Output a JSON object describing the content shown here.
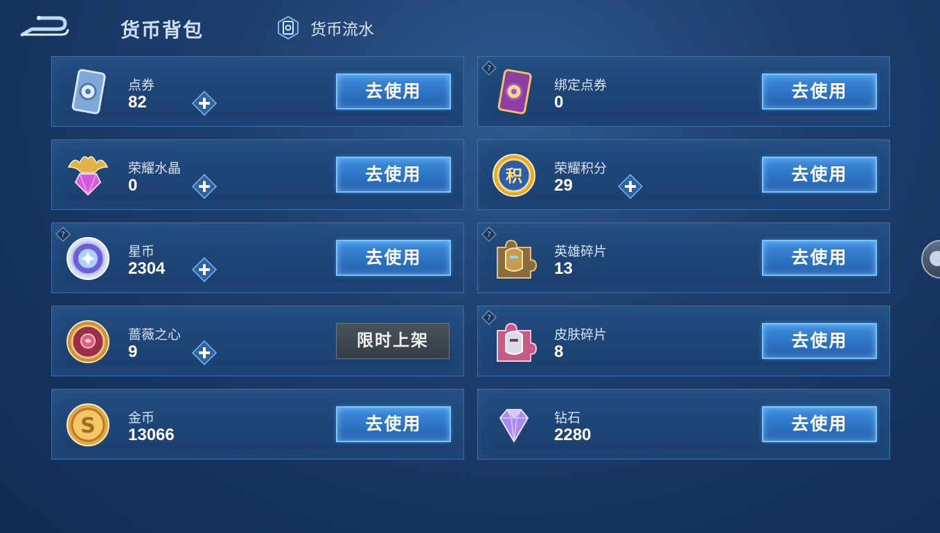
{
  "header": {
    "title": "货币背包",
    "flow_tab_label": "货币流水",
    "back_icon": "back-arrow-icon"
  },
  "currencies": [
    {
      "name": "点券",
      "amount": "82",
      "icon": "voucher-card-blue-icon",
      "has_plus": true,
      "has_help": false,
      "action": "去使用"
    },
    {
      "name": "绑定点券",
      "amount": "0",
      "icon": "voucher-card-purple-icon",
      "has_plus": false,
      "has_help": true,
      "action": "去使用"
    },
    {
      "name": "荣耀水晶",
      "amount": "0",
      "icon": "glory-crystal-icon",
      "has_plus": true,
      "has_help": false,
      "action": "去使用"
    },
    {
      "name": "荣耀积分",
      "amount": "29",
      "icon": "glory-points-coin-icon",
      "has_plus": true,
      "has_help": false,
      "action": "去使用"
    },
    {
      "name": "星币",
      "amount": "2304",
      "icon": "star-coin-icon",
      "has_plus": true,
      "has_help": true,
      "action": "去使用"
    },
    {
      "name": "英雄碎片",
      "amount": "13",
      "icon": "hero-fragment-icon",
      "has_plus": false,
      "has_help": true,
      "action": "去使用"
    },
    {
      "name": "蔷薇之心",
      "amount": "9",
      "icon": "rose-heart-icon",
      "has_plus": true,
      "has_help": false,
      "action": "限时上架"
    },
    {
      "name": "皮肤碎片",
      "amount": "8",
      "icon": "skin-fragment-icon",
      "has_plus": false,
      "has_help": true,
      "action": "去使用"
    },
    {
      "name": "金币",
      "amount": "13066",
      "icon": "gold-coin-icon",
      "has_plus": false,
      "has_help": false,
      "action": "去使用"
    },
    {
      "name": "钻石",
      "amount": "2280",
      "icon": "diamond-icon",
      "has_plus": false,
      "has_help": false,
      "action": "去使用"
    }
  ],
  "colors": {
    "background": "#1d3e6c",
    "card_border": "#3f6fa6",
    "use_button": "#2f75c6",
    "limited_button": "#3f464f"
  }
}
